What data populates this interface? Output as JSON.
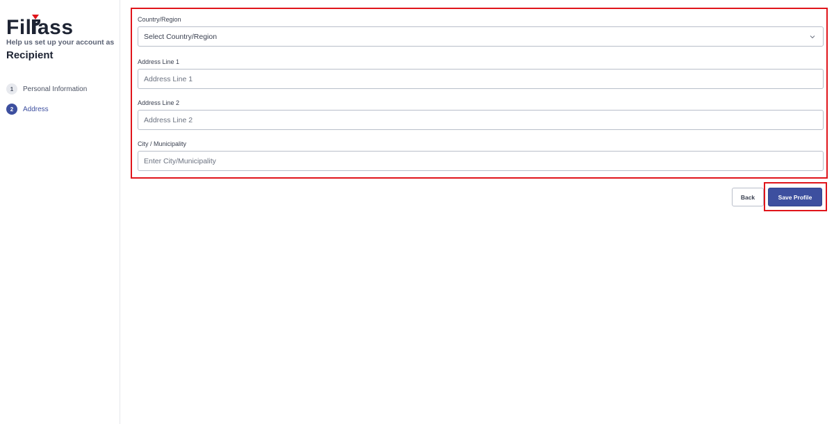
{
  "sidebar": {
    "logo_text": "FilPass",
    "tagline": "Help us set up your account as",
    "role": "Recipient",
    "steps": [
      {
        "number": "1",
        "label": "Personal Information",
        "state": "inactive"
      },
      {
        "number": "2",
        "label": "Address",
        "state": "active"
      }
    ]
  },
  "form": {
    "country": {
      "label": "Country/Region",
      "placeholder": "Select Country/Region",
      "icon": "chevron-down-icon"
    },
    "address1": {
      "label": "Address Line 1",
      "placeholder": "Address Line 1"
    },
    "address2": {
      "label": "Address Line 2",
      "placeholder": "Address Line 2"
    },
    "city": {
      "label": "City / Municipality",
      "placeholder": "Enter City/Municipality"
    }
  },
  "actions": {
    "back_label": "Back",
    "save_label": "Save Profile"
  },
  "colors": {
    "brand_navy": "#1e2433",
    "brand_red": "#e0141a",
    "primary": "#3d4f9f",
    "highlight": "#e0141a"
  }
}
